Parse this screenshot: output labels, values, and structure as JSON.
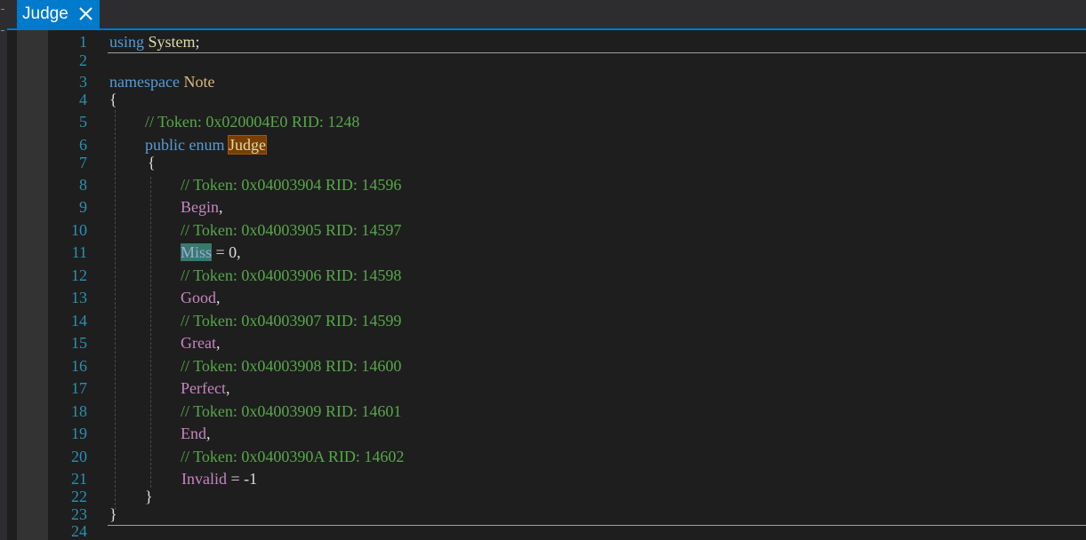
{
  "tab": {
    "title": "Judge",
    "close_glyph": "✕",
    "close_icon": "close-icon"
  },
  "colors": {
    "accent": "#007acc",
    "keyword": "#569cd6",
    "type": "#dcdcaa",
    "comment": "#57a64a",
    "enum_member": "#c586c0",
    "line_number": "#2b91af",
    "highlight_reference": "#7a3e00",
    "highlight_selection": "#37796b"
  },
  "code": {
    "line_numbers": [
      "1",
      "2",
      "3",
      "4",
      "5",
      "6",
      "7",
      "8",
      "9",
      "10",
      "11",
      "12",
      "13",
      "14",
      "15",
      "16",
      "17",
      "18",
      "19",
      "20",
      "21",
      "22",
      "23",
      "24"
    ],
    "line1": {
      "kw": "using",
      "type": "System",
      "punct": ";"
    },
    "line3": {
      "kw": "namespace",
      "name": "Note"
    },
    "line4": "{",
    "line5": "// Token: 0x020004E0 RID: 1248",
    "line6": {
      "kw1": "public",
      "kw2": "enum",
      "name": "Judge"
    },
    "line7": "{",
    "line8": "// Token: 0x04003904 RID: 14596",
    "line9": {
      "member": "Begin",
      "punct": ","
    },
    "line10": "// Token: 0x04003905 RID: 14597",
    "line11": {
      "member": "Miss",
      "rest": " = 0,"
    },
    "line12": "// Token: 0x04003906 RID: 14598",
    "line13": {
      "member": "Good",
      "punct": ","
    },
    "line14": "// Token: 0x04003907 RID: 14599",
    "line15": {
      "member": "Great",
      "punct": ","
    },
    "line16": "// Token: 0x04003908 RID: 14600",
    "line17": {
      "member": "Perfect",
      "punct": ","
    },
    "line18": "// Token: 0x04003909 RID: 14601",
    "line19": {
      "member": "End",
      "punct": ","
    },
    "line20": "// Token: 0x0400390A RID: 14602",
    "line21": {
      "member": "Invalid",
      "rest": " = -1"
    },
    "line22": "}",
    "line23": "}"
  }
}
